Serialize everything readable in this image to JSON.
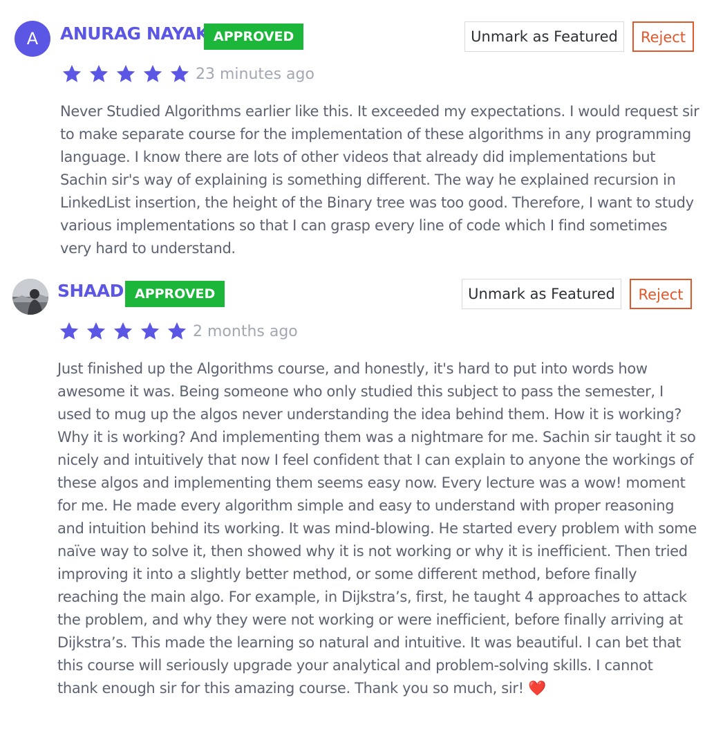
{
  "reviews": [
    {
      "avatar_letter": "A",
      "name": "ANURAG NAYAK",
      "status": "APPROVED",
      "rating": 5,
      "time": "23 minutes ago",
      "feature_label": "Unmark as Featured",
      "reject_label": "Reject",
      "text": "Never Studied Algorithms earlier like this. It exceeded my expectations. I would request sir to make separate course for the implementation of these algorithms in any programming language. I know there are lots of other videos that already did implementations but Sachin sir's way of explaining is something different. The way he explained recursion in LinkedList insertion, the height of the Binary tree was too good. Therefore, I want to study various implementations so that I can grasp every line of code which I find sometimes very hard to understand."
    },
    {
      "avatar_letter": "",
      "name": "SHAAD",
      "status": "APPROVED",
      "rating": 5,
      "time": "2 months ago",
      "feature_label": "Unmark as Featured",
      "reject_label": "Reject",
      "text": "Just finished up the Algorithms course, and honestly, it's hard to put into words how awesome it was. Being someone who only studied this subject to pass the semester, I used to mug up the algos never understanding the idea behind them. How it is working? Why it is working? And implementing them was a nightmare for me. Sachin sir taught it so nicely and intuitively that now I feel confident that I can explain to anyone the workings of these algos and implementing them seems easy now. Every lecture was a wow! moment for me. He made every algorithm simple and easy to understand with proper reasoning and intuition behind its working. It was mind-blowing. He started every problem with some naïve way to solve it, then showed why it is not working or why it is inefficient. Then tried improving it into a slightly better method, or some different method, before finally reaching the main algo. For example, in Dijkstra’s, first, he taught 4 approaches to attack the problem, and why they were not working or were inefficient, before finally arriving at Dijkstra’s. This made the learning so natural and intuitive. It was beautiful. I can bet that this course will seriously upgrade your analytical and problem-solving skills. I cannot thank enough sir for this amazing course. Thank you so much, sir! ❤️"
    }
  ],
  "colors": {
    "accent": "#5b57e4",
    "approved": "#1cb63a",
    "reject": "#e2572a",
    "muted": "#a2a7b3",
    "text": "#5d6272"
  },
  "icons": {
    "star": "star-icon",
    "avatar_photo": "avatar-photo"
  }
}
